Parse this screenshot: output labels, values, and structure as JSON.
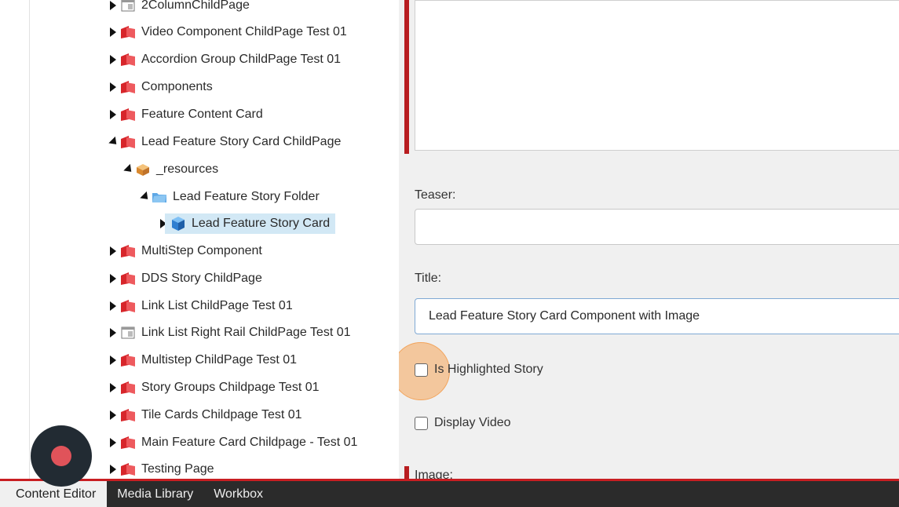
{
  "tree": {
    "items": [
      {
        "label": "2ColumnChildPage",
        "icon": "page-template-icon",
        "expanded": false
      },
      {
        "label": "Video Component ChildPage Test 01",
        "icon": "red-bookmark-icon",
        "expanded": false
      },
      {
        "label": "Accordion Group ChildPage Test 01",
        "icon": "red-bookmark-icon",
        "expanded": false
      },
      {
        "label": "Components",
        "icon": "red-bookmark-icon",
        "expanded": false
      },
      {
        "label": "Feature Content Card",
        "icon": "red-bookmark-icon",
        "expanded": false
      },
      {
        "label": "Lead Feature Story Card ChildPage",
        "icon": "red-bookmark-icon",
        "expanded": true
      },
      {
        "label": "_resources",
        "icon": "box-icon",
        "expanded": true
      },
      {
        "label": "Lead Feature Story Folder",
        "icon": "folder-icon",
        "expanded": true
      },
      {
        "label": "Lead Feature Story Card",
        "icon": "cube-icon",
        "expanded": false,
        "selected": true
      },
      {
        "label": "MultiStep Component",
        "icon": "red-bookmark-icon",
        "expanded": false
      },
      {
        "label": "DDS Story ChildPage",
        "icon": "red-bookmark-icon",
        "expanded": false
      },
      {
        "label": "Link List ChildPage Test 01",
        "icon": "red-bookmark-icon",
        "expanded": false
      },
      {
        "label": "Link List Right Rail ChildPage Test 01",
        "icon": "page-template-icon",
        "expanded": false
      },
      {
        "label": "Multistep ChildPage Test 01",
        "icon": "red-bookmark-icon",
        "expanded": false
      },
      {
        "label": "Story Groups Childpage Test 01",
        "icon": "red-bookmark-icon",
        "expanded": false
      },
      {
        "label": "Tile Cards Childpage Test 01",
        "icon": "red-bookmark-icon",
        "expanded": false
      },
      {
        "label": "Main Feature Card Childpage - Test 01",
        "icon": "red-bookmark-icon",
        "expanded": false
      },
      {
        "label": "Testing Page",
        "icon": "red-bookmark-icon",
        "expanded": false
      }
    ]
  },
  "editor": {
    "teaser_label": "Teaser:",
    "teaser_value": "",
    "title_label": "Title:",
    "title_value": "Lead Feature Story Card Component with Image",
    "highlighted_label": "Is Highlighted Story",
    "highlighted_checked": false,
    "video_label": "Display Video",
    "video_checked": false,
    "image_label": "Image:"
  },
  "bottom_tabs": [
    {
      "label": "Content Editor",
      "active": true
    },
    {
      "label": "Media Library",
      "active": false
    },
    {
      "label": "Workbox",
      "active": false
    }
  ],
  "colors": {
    "accent_red": "#c81e22",
    "selection": "#d2e8f5",
    "highlight": "#f5a65a",
    "record_dot": "#e0535a"
  }
}
